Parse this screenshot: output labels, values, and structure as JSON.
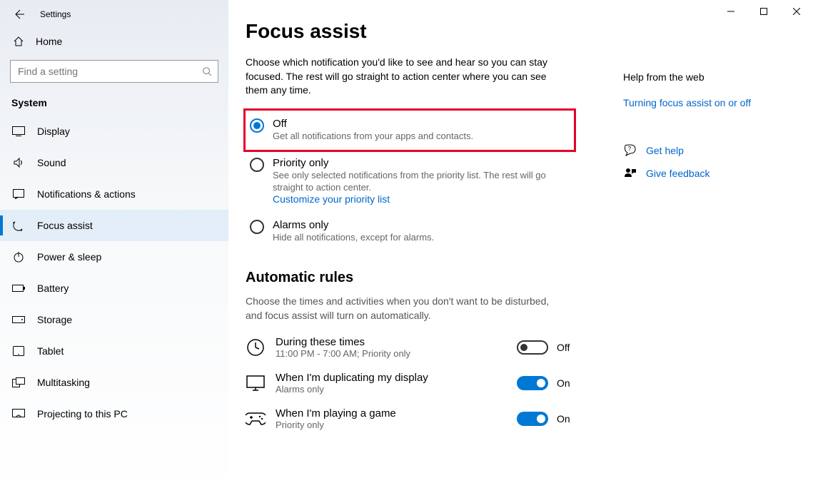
{
  "window": {
    "title": "Settings"
  },
  "sidebar": {
    "home": "Home",
    "search_placeholder": "Find a setting",
    "section": "System",
    "items": [
      {
        "label": "Display"
      },
      {
        "label": "Sound"
      },
      {
        "label": "Notifications & actions"
      },
      {
        "label": "Focus assist"
      },
      {
        "label": "Power & sleep"
      },
      {
        "label": "Battery"
      },
      {
        "label": "Storage"
      },
      {
        "label": "Tablet"
      },
      {
        "label": "Multitasking"
      },
      {
        "label": "Projecting to this PC"
      }
    ]
  },
  "page": {
    "title": "Focus assist",
    "intro": "Choose which notification you'd like to see and hear so you can stay focused. The rest will go straight to action center where you can see them any time.",
    "options": {
      "off": {
        "label": "Off",
        "desc": "Get all notifications from your apps and contacts."
      },
      "priority": {
        "label": "Priority only",
        "desc": "See only selected notifications from the priority list. The rest will go straight to action center.",
        "link": "Customize your priority list"
      },
      "alarms": {
        "label": "Alarms only",
        "desc": "Hide all notifications, except for alarms."
      }
    },
    "rules": {
      "heading": "Automatic rules",
      "desc": "Choose the times and activities when you don't want to be disturbed, and focus assist will turn on automatically.",
      "items": [
        {
          "title": "During these times",
          "sub": "11:00 PM - 7:00 AM; Priority only",
          "state": "Off",
          "on": false
        },
        {
          "title": "When I'm duplicating my display",
          "sub": "Alarms only",
          "state": "On",
          "on": true
        },
        {
          "title": "When I'm playing a game",
          "sub": "Priority only",
          "state": "On",
          "on": true
        }
      ]
    }
  },
  "right": {
    "heading": "Help from the web",
    "link1": "Turning focus assist on or off",
    "help": "Get help",
    "feedback": "Give feedback"
  }
}
